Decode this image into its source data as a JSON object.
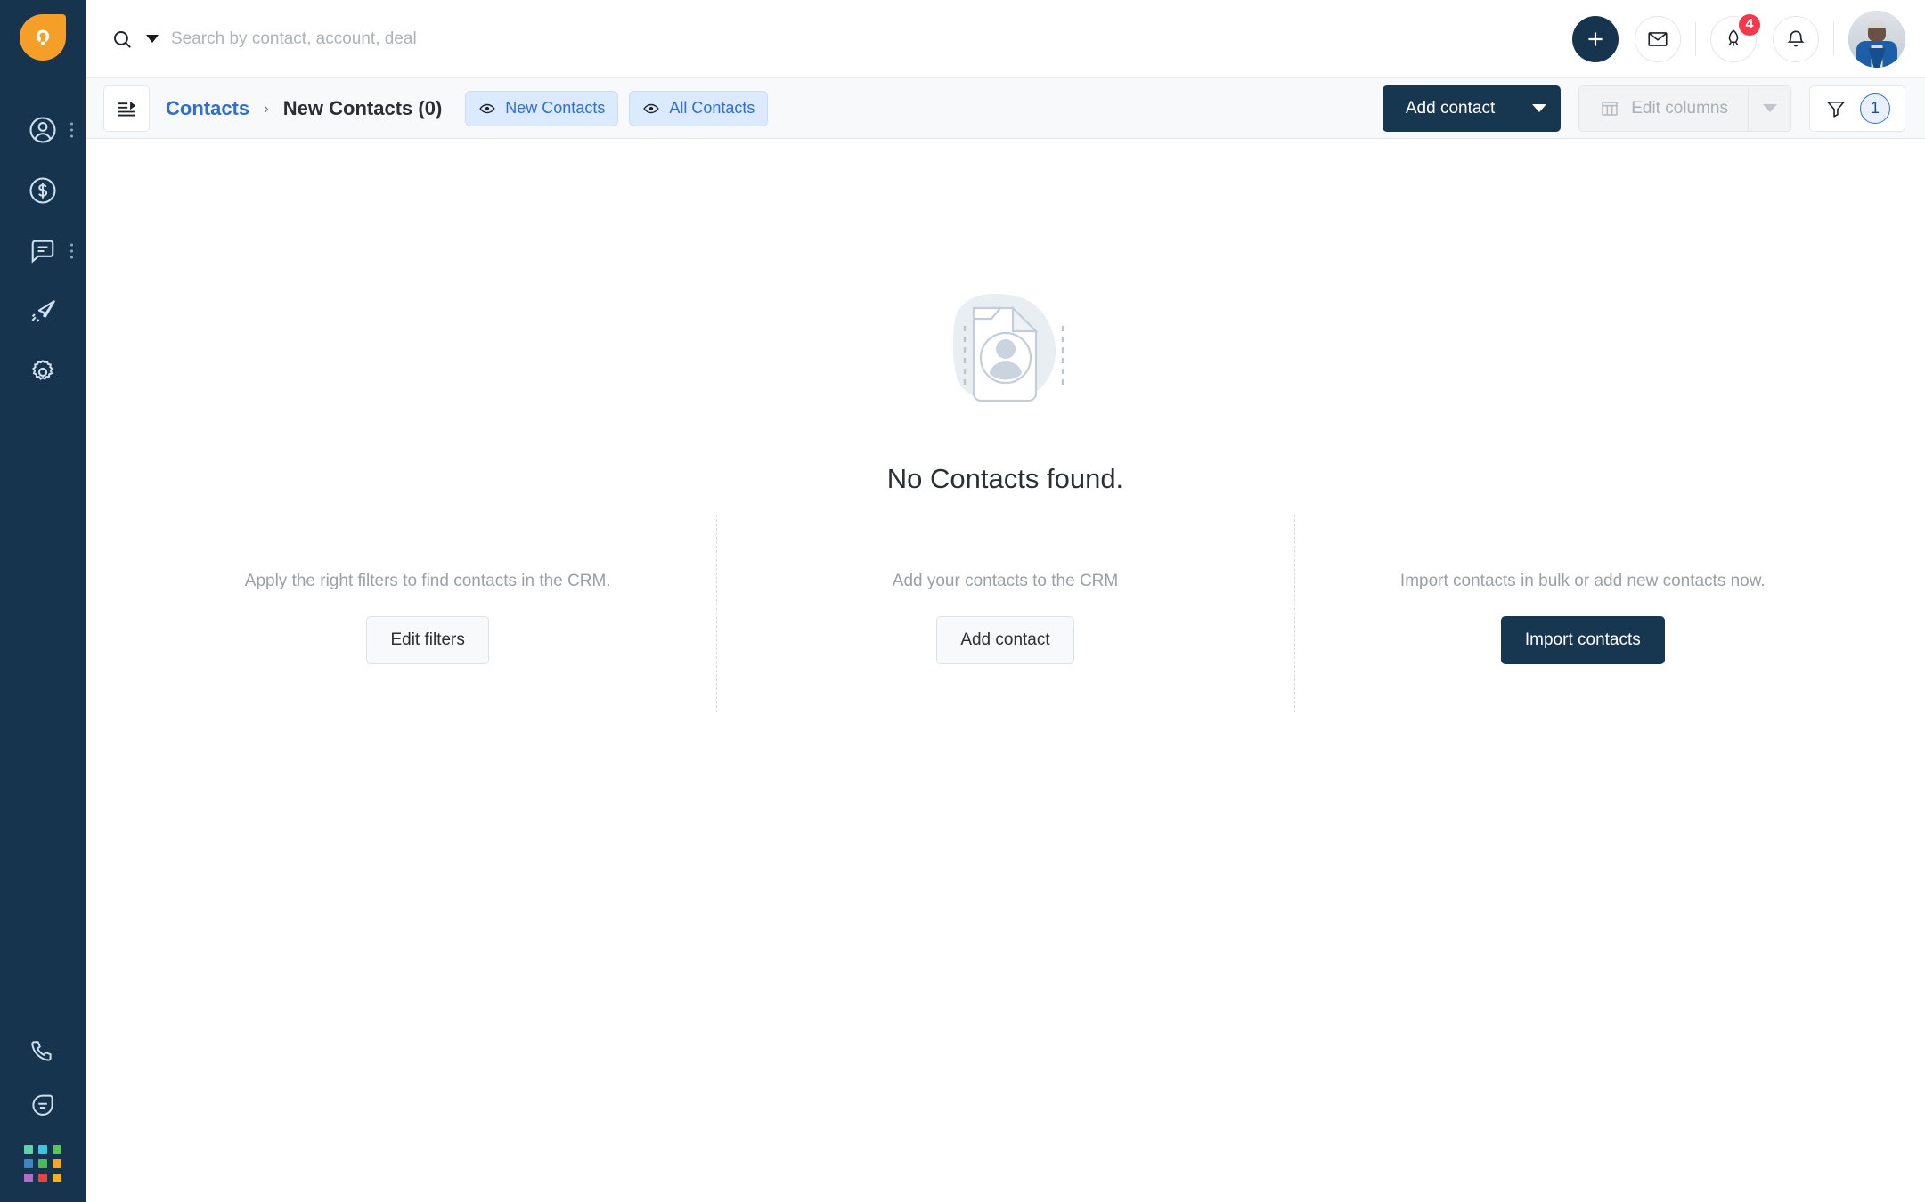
{
  "brand": {
    "logo_icon": "orange-droplet-logo",
    "rail_bg": "#16344d",
    "accent_orange": "#f59f28",
    "accent_dark": "#17364f",
    "accent_blue": "#2f6fd0"
  },
  "sidebar": {
    "items": [
      {
        "icon": "contacts-person-icon",
        "name": "contacts",
        "has_menu": true
      },
      {
        "icon": "deals-dollar-circle-icon",
        "name": "deals",
        "has_menu": false
      },
      {
        "icon": "conversations-chat-icon",
        "name": "conversations",
        "has_menu": true
      },
      {
        "icon": "campaigns-paper-plane-icon",
        "name": "campaigns",
        "has_menu": false
      },
      {
        "icon": "settings-gear-icon",
        "name": "settings",
        "has_menu": false
      }
    ],
    "bottom": [
      {
        "icon": "phone-icon",
        "name": "phone"
      },
      {
        "icon": "help-chat-icon",
        "name": "help"
      }
    ],
    "app_grid_colors": [
      "#5fd3a6",
      "#38c6e0",
      "#5cc45f",
      "#3f86c6",
      "#4cbb56",
      "#f5a623",
      "#b06ec9",
      "#e8453c",
      "#f2b21e"
    ]
  },
  "search": {
    "placeholder": "Search by contact, account, deal",
    "value": "",
    "icon": "search-icon",
    "caret_icon": "chevron-down-icon"
  },
  "topbar": {
    "add_icon": "plus-icon",
    "mail_icon": "envelope-icon",
    "rocket_icon": "rocket-icon",
    "rocket_badge": "4",
    "bell_icon": "bell-icon",
    "avatar_alt": "user-avatar"
  },
  "subheader": {
    "panel_toggle_icon": "panel-list-toggle-icon",
    "breadcrumb_root": "Contacts",
    "breadcrumb_sep": "›",
    "breadcrumb_current": "New Contacts (0)",
    "views": [
      {
        "label": "New Contacts",
        "icon": "eye-icon"
      },
      {
        "label": "All Contacts",
        "icon": "eye-icon"
      }
    ],
    "add_contact_label": "Add contact",
    "add_contact_caret": "chevron-down-icon",
    "edit_columns_label": "Edit columns",
    "edit_columns_icon": "table-columns-icon",
    "edit_columns_caret": "chevron-down-icon",
    "filter_icon": "funnel-filter-icon",
    "filter_count": "1"
  },
  "empty_state": {
    "illustration": "document-contact-placeholder-illustration",
    "title": "No Contacts found.",
    "columns": [
      {
        "text": "Apply the right filters to find contacts in the CRM.",
        "button": "Edit filters",
        "style": "light"
      },
      {
        "text": "Add your contacts to the CRM",
        "button": "Add contact",
        "style": "light"
      },
      {
        "text": "Import contacts in bulk or add new contacts now.",
        "button": "Import contacts",
        "style": "dark"
      }
    ]
  }
}
